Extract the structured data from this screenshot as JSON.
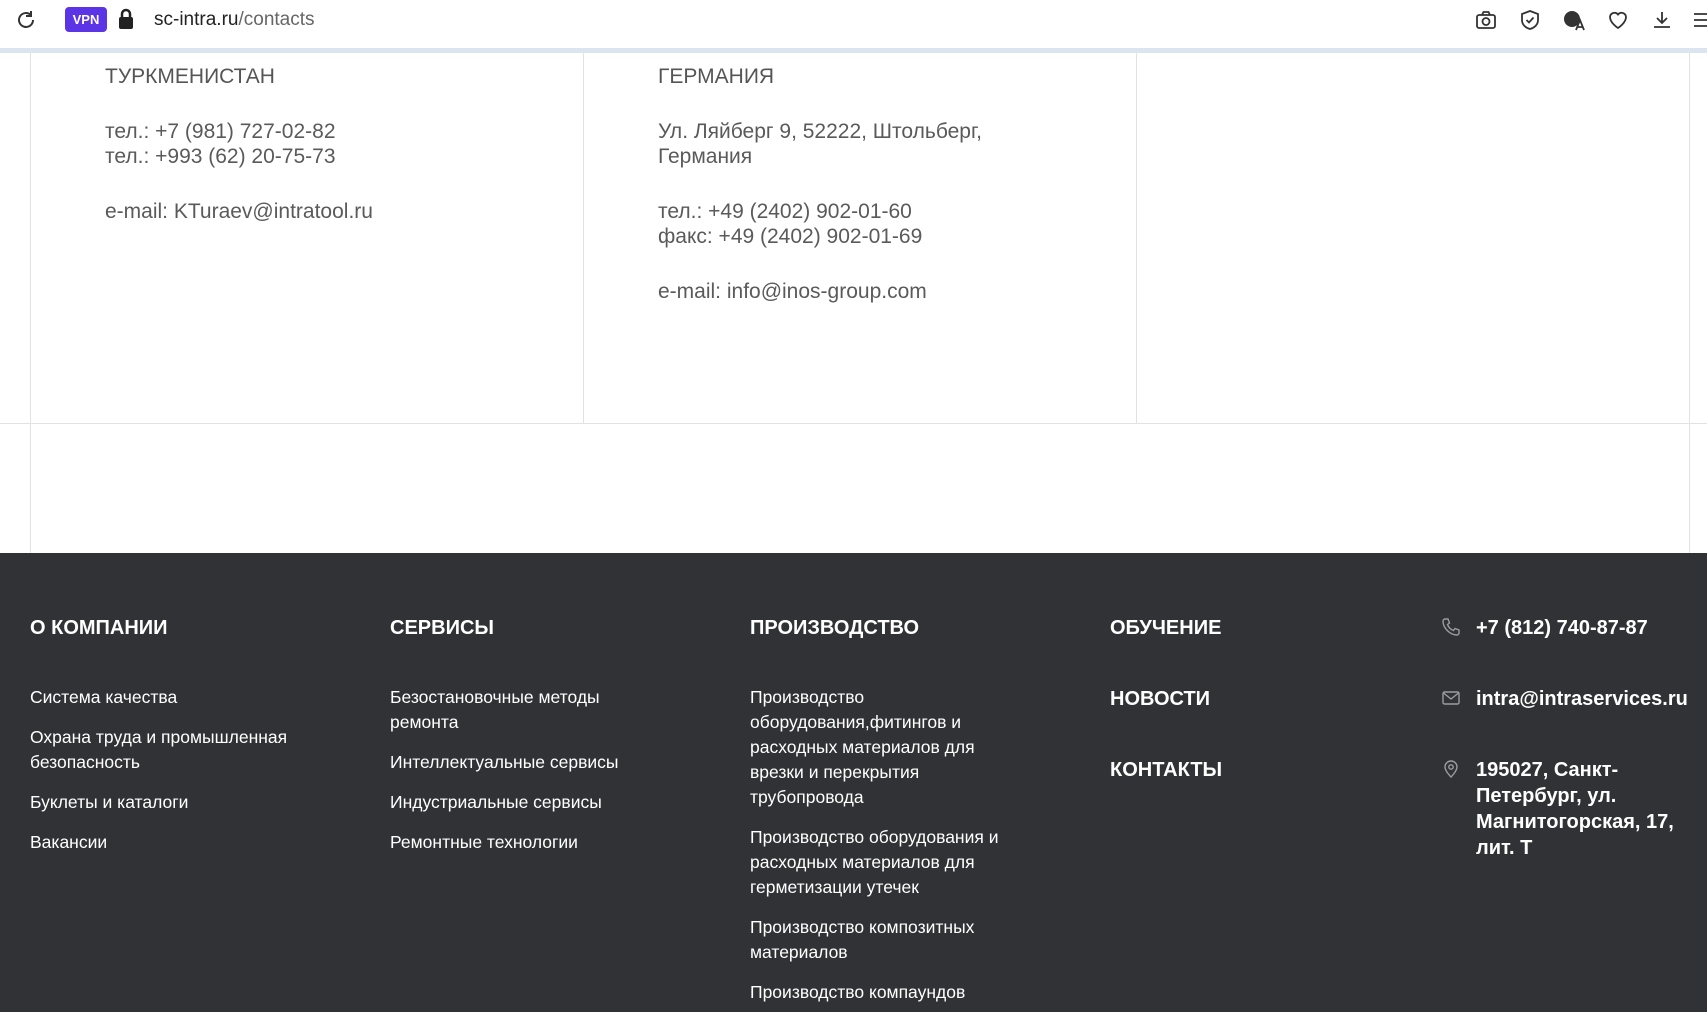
{
  "browser": {
    "vpn_label": "VPN",
    "url_host": "sc-intra.ru",
    "url_path": "/contacts",
    "icons": [
      "reload-icon",
      "lock-icon",
      "camera-icon",
      "shield-icon",
      "translate-icon",
      "heart-icon",
      "download-icon",
      "menu-icon"
    ]
  },
  "contacts": [
    {
      "country": "ТУРКМЕНИСТАН",
      "lines": [
        "тел.: +7 (981) 727-02-82",
        "тел.: +993 (62) 20-75-73"
      ],
      "email": "e-mail: KTuraev@intratool.ru"
    },
    {
      "country": "ГЕРМАНИЯ",
      "address": [
        "Ул. Ляйберг 9, 52222, Штольберг,",
        "Германия"
      ],
      "lines": [
        "тел.: +49 (2402) 902-01-60",
        "факс: +49 (2402) 902-01-69"
      ],
      "email": "e-mail: info@inos-group.com"
    }
  ],
  "footer": {
    "company": {
      "title": "О КОМПАНИИ",
      "items": [
        "Система качества",
        "Охрана труда и промышленная безопасность",
        "Буклеты и каталоги",
        "Вакансии"
      ]
    },
    "services": {
      "title": "СЕРВИСЫ",
      "items": [
        "Безостановочные методы ремонта",
        "Интеллектуальные сервисы",
        "Индустриальные сервисы",
        "Ремонтные технологии"
      ]
    },
    "production": {
      "title": "ПРОИЗВОДСТВО",
      "items": [
        "Производство оборудования,фитингов и расходных материалов для врезки и перекрытия трубопровода",
        "Производство оборудования и расходных материалов для герметизации утечек",
        "Производство композитных материалов",
        "Производство компаундов"
      ]
    },
    "links": [
      "ОБУЧЕНИЕ",
      "НОВОСТИ",
      "КОНТАКТЫ"
    ],
    "phone": "+7 (812) 740-87-87",
    "email": "intra@intraservices.ru",
    "address": "195027, Санкт-Петербург, ул. Магнитогорская, 17, лит. Т"
  }
}
